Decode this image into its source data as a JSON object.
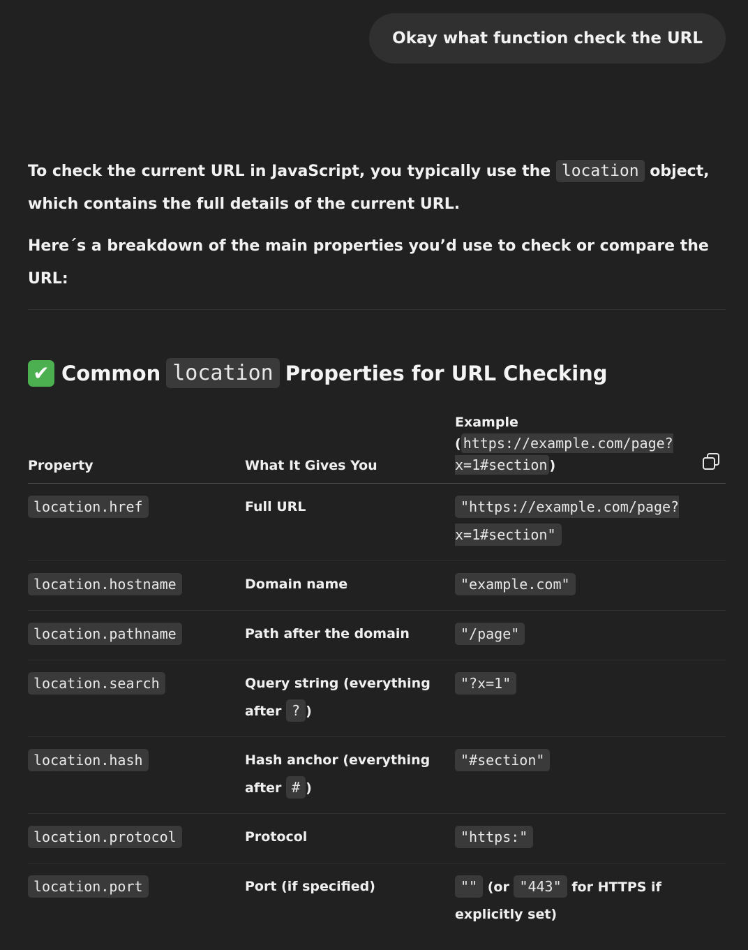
{
  "user_message": "Okay what function check the URL",
  "answer": {
    "intro_before": "To check the current URL in JavaScript, you typically use the ",
    "intro_code": "location",
    "intro_after": " object, which contains the full details of the current URL.",
    "breakdown": "Here´s a breakdown of the main properties you’d use to check or compare the URL:"
  },
  "section": {
    "icon": "white-check-mark-emoji",
    "title_before": "Common ",
    "title_code": "location",
    "title_after": " Properties for URL Checking"
  },
  "table": {
    "headers": {
      "property": "Property",
      "gives": "What It Gives You",
      "example_label": "Example",
      "example_open": "(",
      "example_code": "https://example.com/page?x=1#section",
      "example_close": ")"
    },
    "rows": [
      {
        "property": "location.href",
        "gives": "Full URL",
        "example": "\"https://example.com/page?x=1#section\""
      },
      {
        "property": "location.hostname",
        "gives": "Domain name",
        "example": "\"example.com\""
      },
      {
        "property": "location.pathname",
        "gives": "Path after the domain",
        "example": "\"/page\""
      },
      {
        "property": "location.search",
        "gives_before": "Query string (everything after ",
        "gives_code": "?",
        "gives_after": ")",
        "example": "\"?x=1\""
      },
      {
        "property": "location.hash",
        "gives_before": "Hash anchor (everything after ",
        "gives_code": "#",
        "gives_after": ")",
        "example": "\"#section\""
      },
      {
        "property": "location.protocol",
        "gives": "Protocol",
        "example": "\"https:\""
      },
      {
        "property": "location.port",
        "gives": "Port (if specified)",
        "example": "\"\"",
        "example_mid1": " (or ",
        "example_code2": "\"443\"",
        "example_mid2": " for HTTPS if explicitly set)"
      }
    ]
  },
  "copy_icon": "copy-icon"
}
